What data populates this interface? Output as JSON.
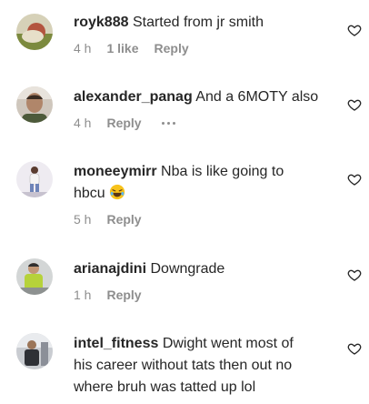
{
  "comments": [
    {
      "username": "royk888",
      "text": "Started from jr smith",
      "time": "4 h",
      "likes": "1 like",
      "reply": "Reply",
      "avatar_color": "#c9c1a0"
    },
    {
      "username": "alexander_panag",
      "text": "And a 6MOTY also",
      "time": "4 h",
      "reply": "Reply",
      "avatar_color": "#8b6b52"
    },
    {
      "username": "moneeymirr",
      "text_line1": "Nba is like going to",
      "text_line2": "hbcu",
      "emoji": "laughing-emoji",
      "time": "5 h",
      "reply": "Reply",
      "avatar_color": "#e9e6ee"
    },
    {
      "username": "arianajdini",
      "text": "Downgrade",
      "time": "1 h",
      "reply": "Reply",
      "avatar_color": "#a7c34a"
    },
    {
      "username": "intel_fitness",
      "text_line1": "Dwight went most of",
      "text_line2": "his career without tats then out no",
      "text_line3": "where bruh was tatted up lol",
      "avatar_color": "#6b6f78"
    }
  ],
  "icons": {
    "like": "heart-outline-icon",
    "more": "more-dots-icon"
  }
}
